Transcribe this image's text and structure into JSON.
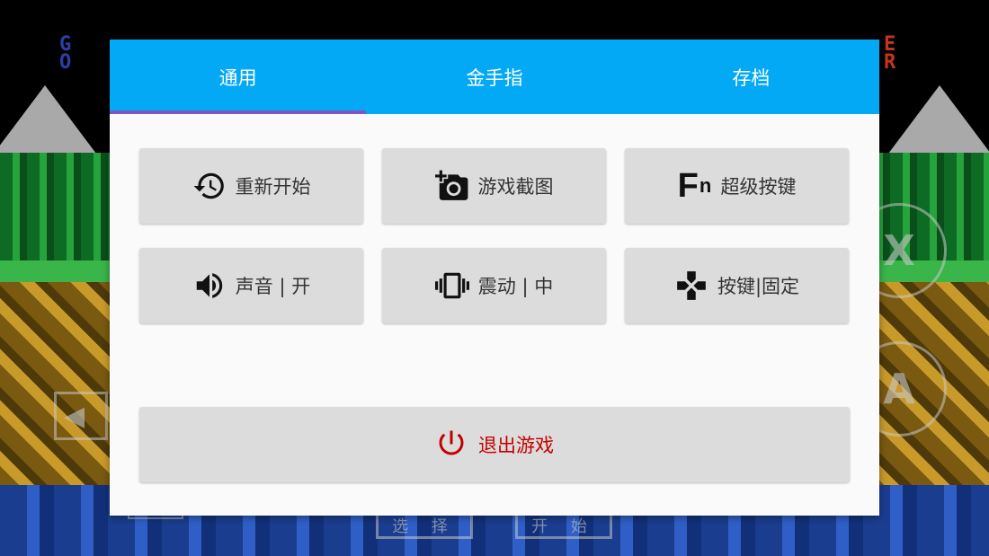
{
  "background": {
    "hud_left": "G\nO",
    "hud_right": "E\nR",
    "pad_x_label": "X",
    "pad_a_label": "A",
    "dpad_left_glyph": "◀",
    "select_label": "选 择",
    "start_label": "开 始"
  },
  "tabs": [
    {
      "label": "通用",
      "active": true
    },
    {
      "label": "金手指",
      "active": false
    },
    {
      "label": "存档",
      "active": false
    }
  ],
  "tiles": [
    {
      "label": "重新开始",
      "icon": "restart-history-icon"
    },
    {
      "label": "游戏截图",
      "icon": "add-camera-icon"
    },
    {
      "label": "超级按键",
      "icon": "fn-icon"
    },
    {
      "label": "声音 | 开",
      "icon": "volume-icon"
    },
    {
      "label": "震动 | 中",
      "icon": "vibration-icon"
    },
    {
      "label": "按键|固定",
      "icon": "gamepad-icon"
    }
  ],
  "fn_icon": {
    "big": "F",
    "small": "n"
  },
  "exit": {
    "label": "退出游戏",
    "icon": "power-icon"
  },
  "colors": {
    "tab_bar": "#03a9f4",
    "tab_indicator": "#7e57c2",
    "tile_bg": "#dcdcdc",
    "exit_text": "#c40000"
  }
}
